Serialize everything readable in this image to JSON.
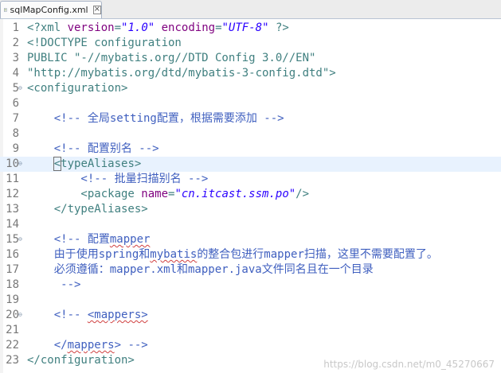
{
  "tab": {
    "label": "sqlMapConfig.xml"
  },
  "watermark": "https://blog.csdn.net/m0_45270667",
  "lines": [
    {
      "n": "1",
      "parts": [
        [
          "pi",
          "<?xml "
        ],
        [
          "attr",
          "version"
        ],
        [
          "pi",
          "="
        ],
        [
          "val",
          "\"1.0\""
        ],
        [
          "pi",
          " "
        ],
        [
          "attr",
          "encoding"
        ],
        [
          "pi",
          "="
        ],
        [
          "val",
          "\"UTF-8\""
        ],
        [
          "pi",
          " ?>"
        ]
      ]
    },
    {
      "n": "2",
      "parts": [
        [
          "doc",
          "<!DOCTYPE configuration"
        ]
      ]
    },
    {
      "n": "3",
      "parts": [
        [
          "doc",
          "PUBLIC \"-//mybatis.org//DTD Config 3.0//EN\""
        ]
      ]
    },
    {
      "n": "4",
      "parts": [
        [
          "doc",
          "\"http://mybatis.org/dtd/mybatis-3-config.dtd\">"
        ]
      ]
    },
    {
      "n": "5",
      "parts": [
        [
          "tag",
          "<configuration>"
        ]
      ]
    },
    {
      "n": "6",
      "parts": []
    },
    {
      "n": "7",
      "parts": [
        [
          "com",
          "    <!-- 全局setting配置，根据需要添加 -->"
        ]
      ]
    },
    {
      "n": "8",
      "parts": []
    },
    {
      "n": "9",
      "parts": [
        [
          "com",
          "    <!-- 配置别名 -->"
        ]
      ]
    },
    {
      "n": "10",
      "parts": [
        [
          "tag",
          "    "
        ],
        [
          "tagbox",
          "<"
        ],
        [
          "tag",
          "typeAliases>"
        ]
      ]
    },
    {
      "n": "11",
      "parts": [
        [
          "com",
          "        <!-- 批量扫描别名 -->"
        ]
      ]
    },
    {
      "n": "12",
      "parts": [
        [
          "tag",
          "        <package "
        ],
        [
          "attr",
          "name"
        ],
        [
          "tag",
          "="
        ],
        [
          "val",
          "\"cn.itcast.ssm.po\""
        ],
        [
          "tag",
          "/>"
        ]
      ]
    },
    {
      "n": "13",
      "parts": [
        [
          "tag",
          "    </typeAliases>"
        ]
      ]
    },
    {
      "n": "14",
      "parts": []
    },
    {
      "n": "15",
      "parts": [
        [
          "com",
          "    <!-- 配置"
        ],
        [
          "comsq",
          "mapper"
        ]
      ]
    },
    {
      "n": "16",
      "parts": [
        [
          "com",
          "    由于使用spring和"
        ],
        [
          "comsq",
          "mybatis"
        ],
        [
          "com",
          "的整合包进行mapper扫描，这里不需要配置了。"
        ]
      ]
    },
    {
      "n": "17",
      "parts": [
        [
          "com",
          "    必须遵循：mapper.xml和mapper.java文件同名且在一个目录"
        ]
      ]
    },
    {
      "n": "18",
      "parts": [
        [
          "com",
          "     -->"
        ]
      ]
    },
    {
      "n": "19",
      "parts": []
    },
    {
      "n": "20",
      "parts": [
        [
          "com",
          "    <!-- "
        ],
        [
          "comsq",
          "<mappers>"
        ]
      ]
    },
    {
      "n": "21",
      "parts": []
    },
    {
      "n": "22",
      "parts": [
        [
          "com",
          "    </"
        ],
        [
          "comsq",
          "mappers"
        ],
        [
          "com",
          "> -->"
        ]
      ]
    },
    {
      "n": "23",
      "parts": [
        [
          "tag",
          "</configuration>"
        ]
      ]
    }
  ]
}
